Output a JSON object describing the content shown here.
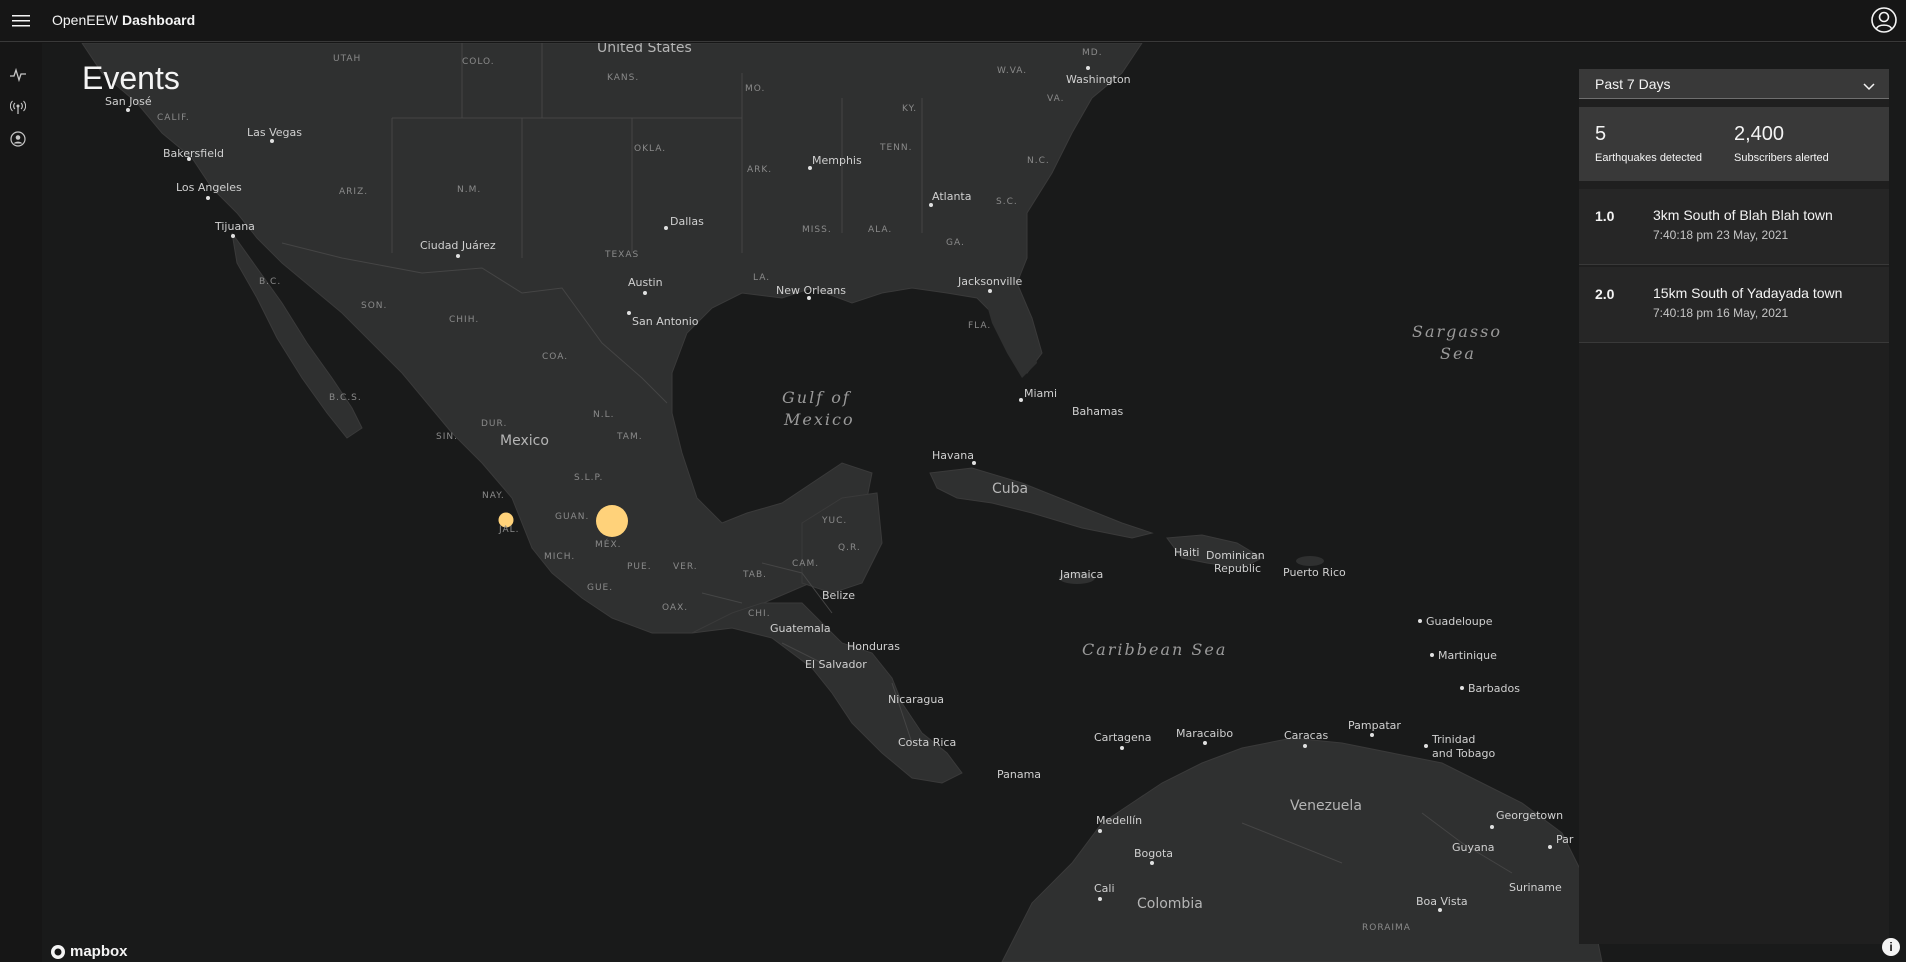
{
  "header": {
    "app_name_plain": "OpenEEW",
    "app_name_bold": "Dashboard",
    "icons": {
      "menu": "hamburger-menu-icon",
      "user": "user-avatar-icon"
    }
  },
  "sidenav": {
    "items": [
      {
        "name": "events-nav",
        "icon": "activity-pulse-icon"
      },
      {
        "name": "sensors-nav",
        "icon": "sensor-broadcast-icon"
      },
      {
        "name": "account-nav",
        "icon": "user-circle-icon"
      }
    ]
  },
  "page": {
    "title": "Events"
  },
  "filter": {
    "selected": "Past 7 Days"
  },
  "stats": {
    "earthquakes_value": "5",
    "earthquakes_label": "Earthquakes detected",
    "subscribers_value": "2,400",
    "subscribers_label": "Subscribers alerted"
  },
  "events": [
    {
      "magnitude": "1.0",
      "place": "3km South of Blah Blah town",
      "time": "7:40:18 pm",
      "date": "23 May, 2021"
    },
    {
      "magnitude": "2.0",
      "place": "15km South of Yadayada town",
      "time": "7:40:18 pm",
      "date": "16 May, 2021"
    }
  ],
  "map": {
    "attribution": "mapbox",
    "info_label": "i",
    "marker_color": "#ffd27a",
    "labels": {
      "countries": [
        "United States",
        "Mexico",
        "Cuba",
        "Colombia",
        "Venezuela"
      ],
      "seas": [
        "Gulf of",
        "Mexico",
        "Caribbean Sea",
        "Sargasso",
        "Sea"
      ],
      "states": [
        "UTAH",
        "COLO.",
        "KANS.",
        "MO.",
        "KY.",
        "W.VA.",
        "VA.",
        "MD.",
        "CALIF.",
        "ARIZ.",
        "N.M.",
        "OKLA.",
        "ARK.",
        "TENN.",
        "N.C.",
        "S.C.",
        "TEXAS",
        "MISS.",
        "ALA.",
        "GA.",
        "LA.",
        "FLA.",
        "B.C.",
        "SON.",
        "CHIH.",
        "COA.",
        "B.C.S.",
        "DUR.",
        "N.L.",
        "SIN.",
        "TAM.",
        "S.L.P.",
        "NAY.",
        "GUAN.",
        "JAL.",
        "MÉX.",
        "MICH.",
        "PUE.",
        "VER.",
        "GUE.",
        "OAX.",
        "TAB.",
        "CAM.",
        "YUC.",
        "Q.R.",
        "CHI.",
        "RORAIMA"
      ],
      "cities": [
        "San José",
        "Las Vegas",
        "Bakersfield",
        "Los Angeles",
        "Tijuana",
        "Ciudad Juárez",
        "Dallas",
        "Austin",
        "San Antonio",
        "Memphis",
        "Atlanta",
        "Washington",
        "New Orleans",
        "Jacksonville",
        "Miami",
        "Bahamas",
        "Havana",
        "Jamaica",
        "Haiti",
        "Dominican",
        "Republic",
        "Puerto Rico",
        "Guadeloupe",
        "Martinique",
        "Barbados",
        "Belize",
        "Guatemala",
        "Honduras",
        "El Salvador",
        "Nicaragua",
        "Costa Rica",
        "Panama",
        "Cartagena",
        "Maracaibo",
        "Caracas",
        "Pampatar",
        "Trinidad",
        "and Tobago",
        "Medellín",
        "Bogota",
        "Cali",
        "Georgetown",
        "Guyana",
        "Suriname",
        "Boa Vista",
        "Par"
      ]
    }
  }
}
